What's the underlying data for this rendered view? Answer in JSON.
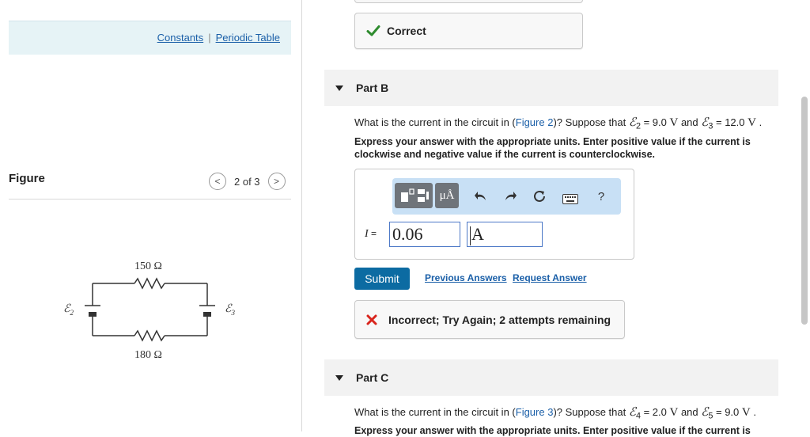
{
  "resources": {
    "constants_label": "Constants",
    "separator": "|",
    "periodic_table_label": "Periodic Table"
  },
  "figure": {
    "heading": "Figure",
    "pager": "2 of 3",
    "prev_symbol": "<",
    "next_symbol": ">",
    "circuit": {
      "top_resistor": "150 Ω",
      "bottom_resistor": "180 Ω",
      "left_source": "ℰ",
      "left_source_sub": "2",
      "right_source": "ℰ",
      "right_source_sub": "3"
    }
  },
  "status_correct": "Correct",
  "partB": {
    "title": "Part B",
    "question": {
      "prefix": "What is the current in the circuit in (",
      "fig_link": "Figure 2",
      "mid": ")? Suppose that ",
      "e2": "ℰ",
      "e2_sub": "2",
      "v2": " = 9.0 ",
      "u2": "V",
      "and": " and ",
      "e3": "ℰ",
      "e3_sub": "3",
      "v3": " = 12.0 ",
      "u3": "V",
      "end": " ."
    },
    "instructions": "Express your answer with the appropriate units. Enter positive value if the current is clockwise and negative value if the current is counterclockwise.",
    "toolbar": {
      "units_label": "μÅ",
      "help_label": "?"
    },
    "answer": {
      "variable": "I",
      "equals": " =",
      "value": "0.06",
      "unit": "A"
    },
    "submit_label": "Submit",
    "previous_answers_label": "Previous Answers",
    "request_answer_label": "Request Answer",
    "feedback": "Incorrect; Try Again; 2 attempts remaining"
  },
  "partC": {
    "title": "Part C",
    "question": {
      "prefix": "What is the current in the circuit in (",
      "fig_link": "Figure 3",
      "mid": ")? Suppose that ",
      "e4": "ℰ",
      "e4_sub": "4",
      "v4": " = 2.0 ",
      "u4": "V",
      "and": " and ",
      "e5": "ℰ",
      "e5_sub": "5",
      "v5": " = 9.0 ",
      "u5": "V",
      "end": " ."
    },
    "instructions": "Express your answer with the appropriate units. Enter positive value if the current is"
  },
  "colors": {
    "accent": "#0c6ba2",
    "correct": "#2e8b2e",
    "incorrect": "#d9251d",
    "link": "#1a5fa8"
  }
}
